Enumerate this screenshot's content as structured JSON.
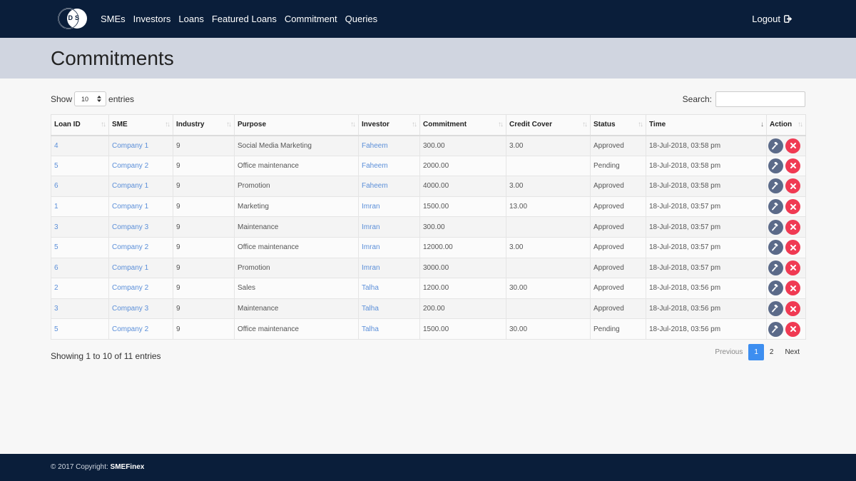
{
  "nav": {
    "items": [
      "SMEs",
      "Investors",
      "Loans",
      "Featured Loans",
      "Commitment",
      "Queries"
    ],
    "logout": "Logout",
    "logo_text": "WDS"
  },
  "page": {
    "title": "Commitments"
  },
  "controls": {
    "show_label": "Show",
    "entries_value": "10",
    "entries_label": "entries",
    "search_label": "Search:",
    "search_value": ""
  },
  "table": {
    "columns": [
      "Loan ID",
      "SME",
      "Industry",
      "Purpose",
      "Investor",
      "Commitment",
      "Credit Cover",
      "Status",
      "Time",
      "Action"
    ],
    "rows": [
      {
        "loan_id": "4",
        "sme": "Company 1",
        "industry": "9",
        "purpose": "Social Media Marketing",
        "investor": "Faheem",
        "commitment": "300.00",
        "credit_cover": "3.00",
        "status": "Approved",
        "time": "18-Jul-2018, 03:58 pm"
      },
      {
        "loan_id": "5",
        "sme": "Company 2",
        "industry": "9",
        "purpose": "Office maintenance",
        "investor": "Faheem",
        "commitment": "2000.00",
        "credit_cover": "",
        "status": "Pending",
        "time": "18-Jul-2018, 03:58 pm"
      },
      {
        "loan_id": "6",
        "sme": "Company 1",
        "industry": "9",
        "purpose": "Promotion",
        "investor": "Faheem",
        "commitment": "4000.00",
        "credit_cover": "3.00",
        "status": "Approved",
        "time": "18-Jul-2018, 03:58 pm"
      },
      {
        "loan_id": "1",
        "sme": "Company 1",
        "industry": "9",
        "purpose": "Marketing",
        "investor": "Imran",
        "commitment": "1500.00",
        "credit_cover": "13.00",
        "status": "Approved",
        "time": "18-Jul-2018, 03:57 pm"
      },
      {
        "loan_id": "3",
        "sme": "Company 3",
        "industry": "9",
        "purpose": "Maintenance",
        "investor": "Imran",
        "commitment": "300.00",
        "credit_cover": "",
        "status": "Approved",
        "time": "18-Jul-2018, 03:57 pm"
      },
      {
        "loan_id": "5",
        "sme": "Company 2",
        "industry": "9",
        "purpose": "Office maintenance",
        "investor": "Imran",
        "commitment": "12000.00",
        "credit_cover": "3.00",
        "status": "Approved",
        "time": "18-Jul-2018, 03:57 pm"
      },
      {
        "loan_id": "6",
        "sme": "Company 1",
        "industry": "9",
        "purpose": "Promotion",
        "investor": "Imran",
        "commitment": "3000.00",
        "credit_cover": "",
        "status": "Approved",
        "time": "18-Jul-2018, 03:57 pm"
      },
      {
        "loan_id": "2",
        "sme": "Company 2",
        "industry": "9",
        "purpose": "Sales",
        "investor": "Talha",
        "commitment": "1200.00",
        "credit_cover": "30.00",
        "status": "Approved",
        "time": "18-Jul-2018, 03:56 pm"
      },
      {
        "loan_id": "3",
        "sme": "Company 3",
        "industry": "9",
        "purpose": "Maintenance",
        "investor": "Talha",
        "commitment": "200.00",
        "credit_cover": "",
        "status": "Approved",
        "time": "18-Jul-2018, 03:56 pm"
      },
      {
        "loan_id": "5",
        "sme": "Company 2",
        "industry": "9",
        "purpose": "Office maintenance",
        "investor": "Talha",
        "commitment": "1500.00",
        "credit_cover": "30.00",
        "status": "Pending",
        "time": "18-Jul-2018, 03:56 pm"
      }
    ],
    "action_icons": [
      "gavel-icon",
      "close-icon"
    ]
  },
  "info": "Showing 1 to 10 of 11 entries",
  "pagination": {
    "previous": "Previous",
    "pages": [
      "1",
      "2"
    ],
    "current": "1",
    "next": "Next"
  },
  "footer": {
    "text": "© 2017 Copyright: ",
    "brand": "SMEFinex"
  },
  "colors": {
    "navbar": "#0a1e3a",
    "header_band": "#d0d5e0",
    "link": "#5b8fd9",
    "gavel_button": "#5b6a89",
    "cancel_button": "#f03a53",
    "active_page": "#3d8ef0"
  }
}
